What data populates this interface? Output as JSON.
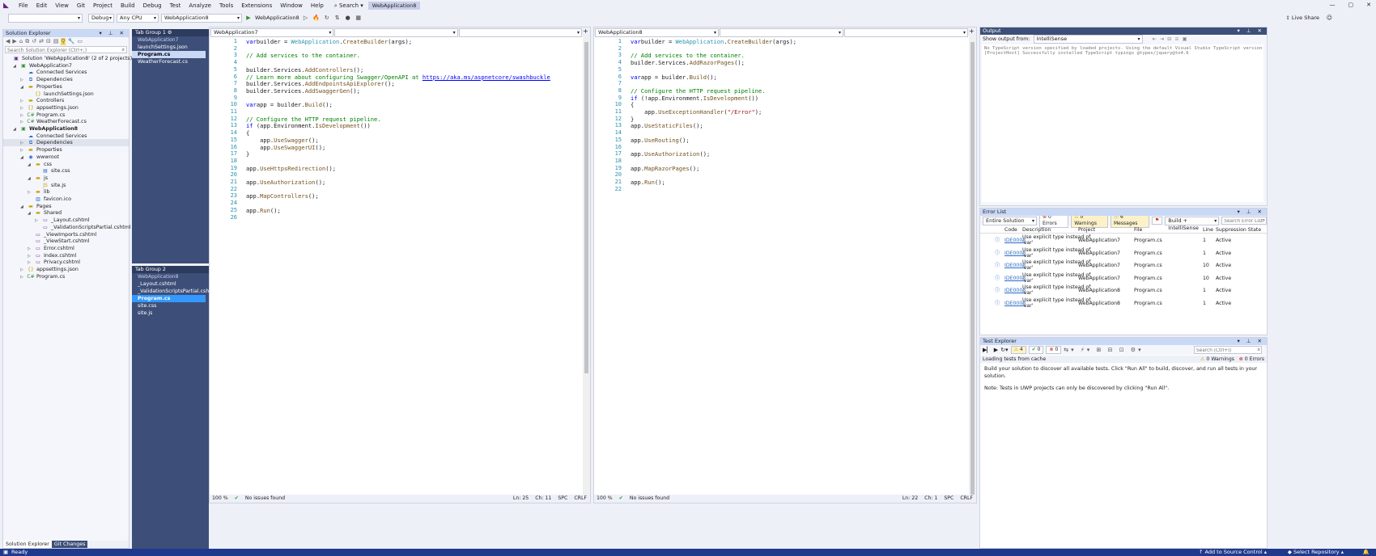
{
  "menubar": {
    "items": [
      "File",
      "Edit",
      "View",
      "Git",
      "Project",
      "Build",
      "Debug",
      "Test",
      "Analyze",
      "Tools",
      "Extensions",
      "Window",
      "Help"
    ],
    "search_label": "Search",
    "window_title": "WebApplication8"
  },
  "toolbar": {
    "config": "Debug",
    "platform": "Any CPU",
    "project": "WebApplication8",
    "run_label": "WebApplication8",
    "live_share": "Live Share"
  },
  "solution_explorer": {
    "title": "Solution Explorer",
    "search_placeholder": "Search Solution Explorer (Ctrl+;)",
    "tabs": [
      "Solution Explorer",
      "Git Changes"
    ],
    "rows": [
      {
        "text": "Solution 'WebApplication8' (2 of 2 projects)",
        "icon": "solution-icon",
        "indent": 0,
        "arrow": ""
      },
      {
        "text": "WebApplication7",
        "icon": "project-icon",
        "indent": 1,
        "arrow": "▲"
      },
      {
        "text": "Connected Services",
        "icon": "connected-services-icon",
        "indent": 2,
        "arrow": ""
      },
      {
        "text": "Dependencies",
        "icon": "dependencies-icon",
        "indent": 2,
        "arrow": "▶"
      },
      {
        "text": "Properties",
        "icon": "folder-icon",
        "indent": 2,
        "arrow": "▲"
      },
      {
        "text": "launchSettings.json",
        "icon": "json-file-icon",
        "indent": 3,
        "arrow": ""
      },
      {
        "text": "Controllers",
        "icon": "folder-icon",
        "indent": 2,
        "arrow": "▶"
      },
      {
        "text": "appsettings.json",
        "icon": "json-file-icon",
        "indent": 2,
        "arrow": "▶"
      },
      {
        "text": "Program.cs",
        "icon": "csharp-file-icon",
        "indent": 2,
        "arrow": "▶"
      },
      {
        "text": "WeatherForecast.cs",
        "icon": "csharp-file-icon",
        "indent": 2,
        "arrow": "▶"
      },
      {
        "text": "WebApplication8",
        "icon": "project-icon",
        "indent": 1,
        "arrow": "▲",
        "bold": true
      },
      {
        "text": "Connected Services",
        "icon": "connected-services-icon",
        "indent": 2,
        "arrow": ""
      },
      {
        "text": "Dependencies",
        "icon": "dependencies-icon",
        "indent": 2,
        "arrow": "▶",
        "selected": true
      },
      {
        "text": "Properties",
        "icon": "folder-icon",
        "indent": 2,
        "arrow": "▶"
      },
      {
        "text": "wwwroot",
        "icon": "globe-icon",
        "indent": 2,
        "arrow": "▲"
      },
      {
        "text": "css",
        "icon": "folder-icon",
        "indent": 3,
        "arrow": "▲"
      },
      {
        "text": "site.css",
        "icon": "css-file-icon",
        "indent": 4,
        "arrow": ""
      },
      {
        "text": "js",
        "icon": "folder-icon",
        "indent": 3,
        "arrow": "▲"
      },
      {
        "text": "site.js",
        "icon": "js-file-icon",
        "indent": 4,
        "arrow": ""
      },
      {
        "text": "lib",
        "icon": "folder-icon",
        "indent": 3,
        "arrow": "▶"
      },
      {
        "text": "favicon.ico",
        "icon": "image-file-icon",
        "indent": 3,
        "arrow": ""
      },
      {
        "text": "Pages",
        "icon": "folder-icon",
        "indent": 2,
        "arrow": "▲"
      },
      {
        "text": "Shared",
        "icon": "folder-icon",
        "indent": 3,
        "arrow": "▲"
      },
      {
        "text": "_Layout.cshtml",
        "icon": "razor-file-icon",
        "indent": 4,
        "arrow": "▶"
      },
      {
        "text": "_ValidationScriptsPartial.cshtml",
        "icon": "razor-file-icon",
        "indent": 4,
        "arrow": ""
      },
      {
        "text": "_ViewImports.cshtml",
        "icon": "razor-file-icon",
        "indent": 3,
        "arrow": ""
      },
      {
        "text": "_ViewStart.cshtml",
        "icon": "razor-file-icon",
        "indent": 3,
        "arrow": ""
      },
      {
        "text": "Error.cshtml",
        "icon": "razor-file-icon",
        "indent": 3,
        "arrow": "▶"
      },
      {
        "text": "Index.cshtml",
        "icon": "razor-file-icon",
        "indent": 3,
        "arrow": "▶"
      },
      {
        "text": "Privacy.cshtml",
        "icon": "razor-file-icon",
        "indent": 3,
        "arrow": "▶"
      },
      {
        "text": "appsettings.json",
        "icon": "json-file-icon",
        "indent": 2,
        "arrow": "▶"
      },
      {
        "text": "Program.cs",
        "icon": "csharp-file-icon",
        "indent": 2,
        "arrow": "▶"
      }
    ]
  },
  "tab_group_1": {
    "title": "Tab Group 1",
    "project": "WebApplication7",
    "items": [
      "launchSettings.json",
      "Program.cs",
      "WeatherForecast.cs"
    ],
    "selected": "Program.cs"
  },
  "tab_group_2": {
    "title": "Tab Group 2",
    "project": "WebApplication8",
    "items": [
      "_Layout.cshtml",
      "_ValidationScriptsPartial.cshtml",
      "Program.cs",
      "site.css",
      "site.js"
    ],
    "selected": "Program.cs"
  },
  "editor_left": {
    "project": "WebApplication7",
    "zoom": "100 %",
    "issues": "No issues found",
    "line": "Ln: 25",
    "col": "Ch: 11",
    "spc": "SPC",
    "eol": "CRLF",
    "lines": [
      [
        [
          "kw",
          "var"
        ],
        [
          "",
          "builder = "
        ],
        [
          "ty",
          "WebApplication"
        ],
        [
          "",
          "."
        ],
        [
          "mt",
          "CreateBuilder"
        ],
        [
          "",
          "(args);"
        ]
      ],
      [],
      [
        [
          "cm",
          "// Add services to the container."
        ]
      ],
      [],
      [
        [
          "",
          "builder.Services."
        ],
        [
          "mt",
          "AddControllers"
        ],
        [
          "",
          "();"
        ]
      ],
      [
        [
          "cm",
          "// Learn more about configuring Swagger/OpenAPI at "
        ],
        [
          "lk",
          "https://aka.ms/aspnetcore/swashbuckle"
        ]
      ],
      [
        [
          "",
          "builder.Services."
        ],
        [
          "mt",
          "AddEndpointsApiExplorer"
        ],
        [
          "",
          "();"
        ]
      ],
      [
        [
          "",
          "builder.Services."
        ],
        [
          "mt",
          "AddSwaggerGen"
        ],
        [
          "",
          "();"
        ]
      ],
      [],
      [
        [
          "kw",
          "var"
        ],
        [
          "",
          "app = builder."
        ],
        [
          "mt",
          "Build"
        ],
        [
          "",
          "();"
        ]
      ],
      [],
      [
        [
          "cm",
          "// Configure the HTTP request pipeline."
        ]
      ],
      [
        [
          "kw",
          "if"
        ],
        [
          "",
          " (app.Environment."
        ],
        [
          "mt",
          "IsDevelopment"
        ],
        [
          "",
          "())"
        ]
      ],
      [
        [
          "",
          "{"
        ]
      ],
      [
        [
          "",
          "    app."
        ],
        [
          "mt",
          "UseSwagger"
        ],
        [
          "",
          "();"
        ]
      ],
      [
        [
          "",
          "    app."
        ],
        [
          "mt",
          "UseSwaggerUI"
        ],
        [
          "",
          "();"
        ]
      ],
      [
        [
          "",
          "}"
        ]
      ],
      [],
      [
        [
          "",
          "app."
        ],
        [
          "mt",
          "UseHttpsRedirection"
        ],
        [
          "",
          "();"
        ]
      ],
      [],
      [
        [
          "",
          "app."
        ],
        [
          "mt",
          "UseAuthorization"
        ],
        [
          "",
          "();"
        ]
      ],
      [],
      [
        [
          "",
          "app."
        ],
        [
          "mt",
          "MapControllers"
        ],
        [
          "",
          "();"
        ]
      ],
      [],
      [
        [
          "",
          "app."
        ],
        [
          "mt",
          "Run"
        ],
        [
          "",
          "();"
        ]
      ],
      []
    ]
  },
  "editor_right": {
    "project": "WebApplication8",
    "zoom": "100 %",
    "issues": "No issues found",
    "line": "Ln: 22",
    "col": "Ch: 1",
    "spc": "SPC",
    "eol": "CRLF",
    "lines": [
      [
        [
          "kw",
          "var"
        ],
        [
          "",
          "builder = "
        ],
        [
          "ty",
          "WebApplication"
        ],
        [
          "",
          "."
        ],
        [
          "mt",
          "CreateBuilder"
        ],
        [
          "",
          "(args);"
        ]
      ],
      [],
      [
        [
          "cm",
          "// Add services to the container."
        ]
      ],
      [
        [
          "",
          "builder.Services."
        ],
        [
          "mt",
          "AddRazorPages"
        ],
        [
          "",
          "();"
        ]
      ],
      [],
      [
        [
          "kw",
          "var"
        ],
        [
          "",
          "app = builder."
        ],
        [
          "mt",
          "Build"
        ],
        [
          "",
          "();"
        ]
      ],
      [],
      [
        [
          "cm",
          "// Configure the HTTP request pipeline."
        ]
      ],
      [
        [
          "kw",
          "if"
        ],
        [
          "",
          " (!app.Environment."
        ],
        [
          "mt",
          "IsDevelopment"
        ],
        [
          "",
          "())"
        ]
      ],
      [
        [
          "",
          "{"
        ]
      ],
      [
        [
          "",
          "    app."
        ],
        [
          "mt",
          "UseExceptionHandler"
        ],
        [
          "",
          "("
        ],
        [
          "st",
          "\"/Error\""
        ],
        [
          "",
          ");"
        ]
      ],
      [
        [
          "",
          "}"
        ]
      ],
      [
        [
          "",
          "app."
        ],
        [
          "mt",
          "UseStaticFiles"
        ],
        [
          "",
          "();"
        ]
      ],
      [],
      [
        [
          "",
          "app."
        ],
        [
          "mt",
          "UseRouting"
        ],
        [
          "",
          "();"
        ]
      ],
      [],
      [
        [
          "",
          "app."
        ],
        [
          "mt",
          "UseAuthorization"
        ],
        [
          "",
          "();"
        ]
      ],
      [],
      [
        [
          "",
          "app."
        ],
        [
          "mt",
          "MapRazorPages"
        ],
        [
          "",
          "();"
        ]
      ],
      [],
      [
        [
          "",
          "app."
        ],
        [
          "mt",
          "Run"
        ],
        [
          "",
          "();"
        ]
      ],
      []
    ]
  },
  "output": {
    "title": "Output",
    "show_from_label": "Show output from:",
    "source": "IntelliSense",
    "lines": [
      "No TypeScript version specified by loaded projects.  Using the default Visual Studio TypeScript version 4.6",
      "[ProjectHost] Successfully installed TypeScript typings @types/jquery@to4.6"
    ]
  },
  "error_list": {
    "title": "Error List",
    "scope": "Entire Solution",
    "errors": "0 Errors",
    "warnings": "0 Warnings",
    "messages": "6 Messages",
    "build_filter": "Build + IntelliSense",
    "search_placeholder": "Search Error List",
    "columns": [
      "Code",
      "Description",
      "Project",
      "File",
      "Line",
      "Suppression State"
    ],
    "rows": [
      {
        "code": "IDE0008",
        "desc1": "Use explicit type instead of",
        "desc2": "'var'",
        "project": "WebApplication7",
        "file": "Program.cs",
        "line": "1",
        "state": "Active"
      },
      {
        "code": "IDE0008",
        "desc1": "Use explicit type instead of",
        "desc2": "'var'",
        "project": "WebApplication7",
        "file": "Program.cs",
        "line": "1",
        "state": "Active"
      },
      {
        "code": "IDE0008",
        "desc1": "Use explicit type instead of",
        "desc2": "'var'",
        "project": "WebApplication7",
        "file": "Program.cs",
        "line": "10",
        "state": "Active"
      },
      {
        "code": "IDE0008",
        "desc1": "Use explicit type instead of",
        "desc2": "'var'",
        "project": "WebApplication7",
        "file": "Program.cs",
        "line": "10",
        "state": "Active"
      },
      {
        "code": "IDE0008",
        "desc1": "Use explicit type instead of",
        "desc2": "'var'",
        "project": "WebApplication8",
        "file": "Program.cs",
        "line": "1",
        "state": "Active"
      },
      {
        "code": "IDE0008",
        "desc1": "Use explicit type instead of",
        "desc2": "'var'",
        "project": "WebApplication8",
        "file": "Program.cs",
        "line": "1",
        "state": "Active"
      }
    ]
  },
  "test_explorer": {
    "title": "Test Explorer",
    "counts": [
      "4",
      "0",
      "0"
    ],
    "search_placeholder": "Search (Ctrl+I)",
    "loading": "Loading tests from cache",
    "warnings": "0 Warnings",
    "errors": "0 Errors",
    "message1": "Build your solution to discover all available tests. Click \"Run All\" to build, discover, and run all tests in your solution.",
    "message2": "Note: Tests in UWP projects can only be discovered by clicking \"Run All\"."
  },
  "statusbar": {
    "ready": "Ready",
    "source_control": "Add to Source Control",
    "repository": "Select Repository"
  },
  "colors": {
    "accent": "#1f3a8c",
    "tab_group": "#3d4f78",
    "selection": "#3399ff"
  }
}
